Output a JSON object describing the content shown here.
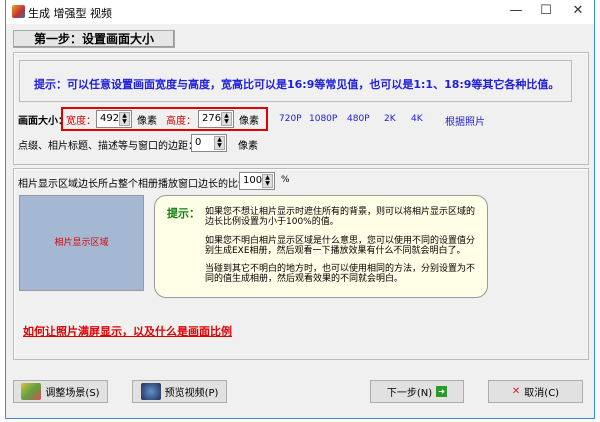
{
  "window": {
    "title": "生成 增强型 视频",
    "minimize": "—",
    "maximize": "☐",
    "close": "✕"
  },
  "step_button": "第一步：设置画面大小",
  "tip": "提示：可以任意设置画面宽度与高度，宽高比可以是16:9等常见值，也可以是1:1、18:9等其它各种比值。",
  "size_row": {
    "label": "画面大小：",
    "width_label": "宽度：",
    "width_value": "492",
    "unit1": "像素",
    "height_label": "高度：",
    "height_value": "276",
    "unit2": "像素",
    "presets": [
      "720P",
      "1080P",
      "480P",
      "2K",
      "4K",
      "根据照片"
    ]
  },
  "margin_row": {
    "label": "点缀、相片标题、描述等与窗口的边距：",
    "value": "0",
    "unit": "像素"
  },
  "ratio_row": {
    "label": "相片显示区域边长所占整个相册播放窗口边长的比例：",
    "value": "100",
    "unit": "%"
  },
  "photo_area": "相片显示区域",
  "hint": {
    "label": "提示：",
    "paragraphs": [
      "如果您不想让相片显示时遮住所有的背景，则可以将相片显示区域的边长比例设置为小于100%的值。",
      "如果您不明白相片显示区域是什么意思，您可以使用不同的设置值分别生成EXE相册，然后观看一下播放效果有什么不同就会明白了。",
      "当碰到其它不明白的地方时，也可以使用相同的方法，分别设置为不同的值生成相册，然后观看效果的不同就会明白。"
    ]
  },
  "help_link": "如何让照片满屏显示，以及什么是画面比例",
  "buttons": {
    "adjust": "调整场景(S)",
    "preview": "预览视频(P)",
    "next": "下一步(N)",
    "cancel": "取消(C)"
  }
}
